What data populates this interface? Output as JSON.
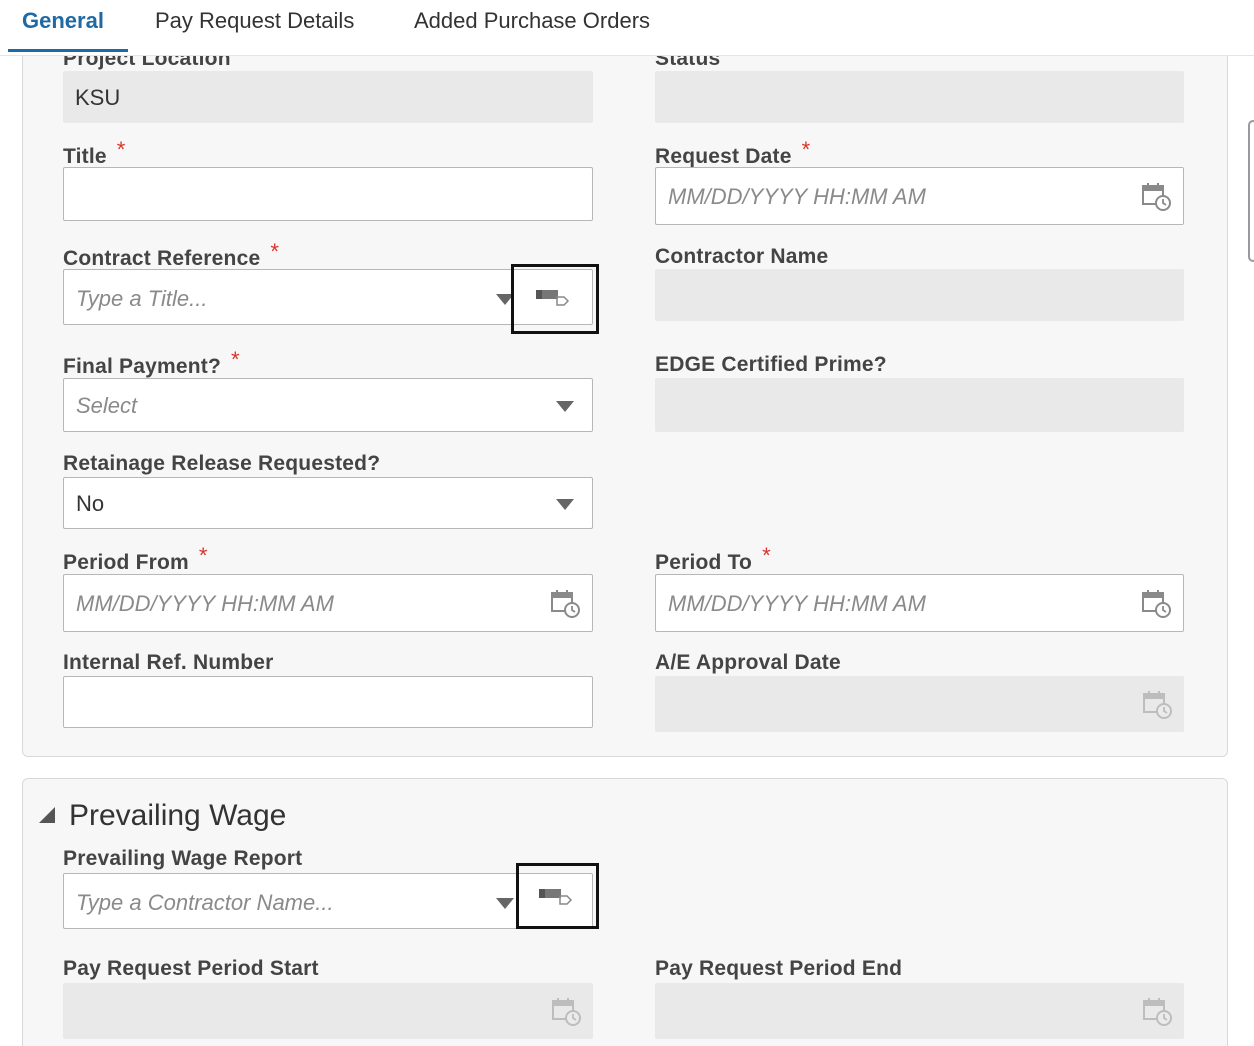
{
  "tabs": [
    {
      "label": "General",
      "active": true
    },
    {
      "label": "Pay Request Details",
      "active": false
    },
    {
      "label": "Added Purchase Orders",
      "active": false
    }
  ],
  "general": {
    "project_location": {
      "label": "Project Location",
      "value": "KSU"
    },
    "status": {
      "label": "Status",
      "value": ""
    },
    "title": {
      "label": "Title",
      "required": true,
      "value": ""
    },
    "request_date": {
      "label": "Request Date",
      "required": true,
      "placeholder": "MM/DD/YYYY HH:MM AM"
    },
    "contract_reference": {
      "label": "Contract Reference",
      "required": true,
      "placeholder": "Type a Title..."
    },
    "contractor_name": {
      "label": "Contractor Name",
      "value": ""
    },
    "final_payment": {
      "label": "Final Payment?",
      "required": true,
      "placeholder": "Select"
    },
    "edge_certified_prime": {
      "label": "EDGE Certified Prime?",
      "value": ""
    },
    "retainage_release": {
      "label": "Retainage Release Requested?",
      "value": "No"
    },
    "period_from": {
      "label": "Period From",
      "required": true,
      "placeholder": "MM/DD/YYYY HH:MM AM"
    },
    "period_to": {
      "label": "Period To",
      "required": true,
      "placeholder": "MM/DD/YYYY HH:MM AM"
    },
    "internal_ref": {
      "label": "Internal Ref. Number",
      "value": ""
    },
    "ae_approval_date": {
      "label": "A/E Approval Date",
      "value": ""
    }
  },
  "prevailing_wage": {
    "section_title": "Prevailing Wage",
    "report": {
      "label": "Prevailing Wage Report",
      "placeholder": "Type a Contractor Name..."
    },
    "period_start": {
      "label": "Pay Request Period Start",
      "value": ""
    },
    "period_end": {
      "label": "Pay Request Period End",
      "value": ""
    }
  },
  "required_marker": "*",
  "colors": {
    "accent": "#1f6aa5",
    "required": "#d9342b",
    "readonly_bg": "#e9e9ea"
  },
  "icons": {
    "calendar": "calendar-clock-icon",
    "lookup": "lookup-tag-icon",
    "dropdown": "chevron-down-icon",
    "collapse": "collapse-triangle-icon"
  }
}
